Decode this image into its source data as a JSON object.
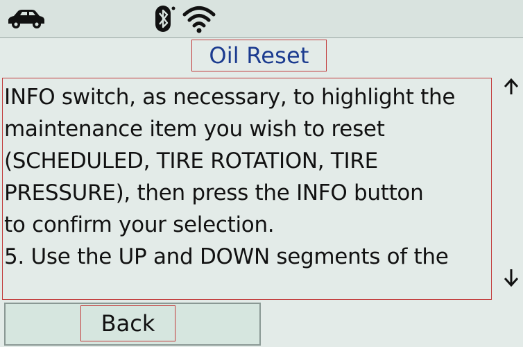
{
  "status_bar": {
    "icons": [
      "car-icon",
      "bluetooth-icon",
      "wifi-icon"
    ]
  },
  "screen": {
    "title": "Oil Reset",
    "body_text": "INFO switch, as necessary, to highlight the\nmaintenance item you wish to reset\n(SCHEDULED, TIRE ROTATION, TIRE\nPRESSURE), then press the INFO button\nto confirm your selection.\n5. Use the UP and DOWN segments of the",
    "scroll_up_glyph": "↑",
    "scroll_down_glyph": "↓"
  },
  "footer": {
    "back_label": "Back"
  },
  "colors": {
    "background": "#e3ebe8",
    "title": "#1b3b8f",
    "highlight_border": "#c23a3a"
  }
}
